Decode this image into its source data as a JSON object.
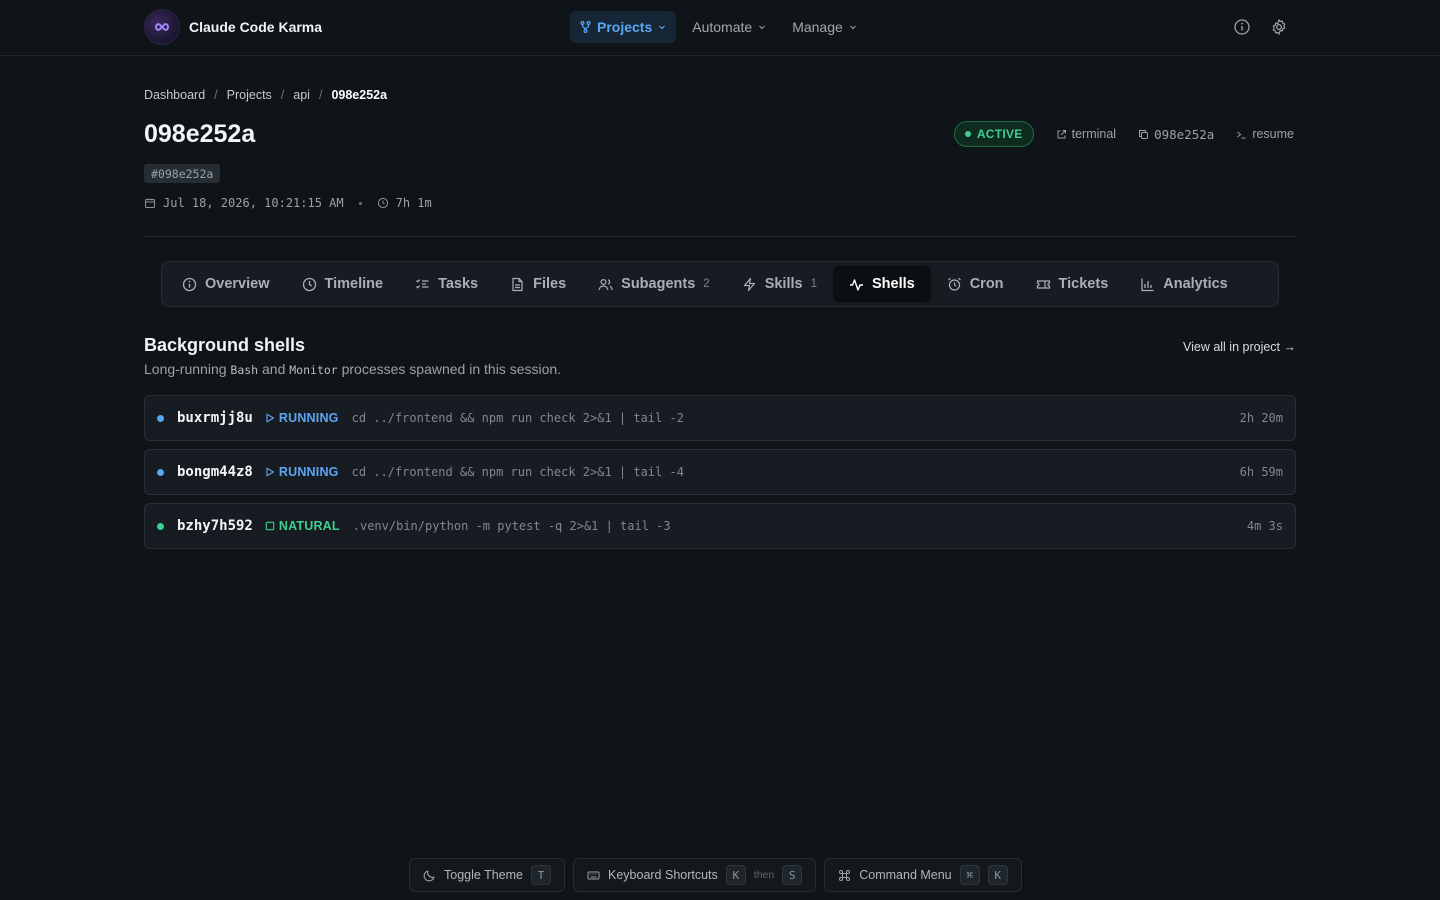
{
  "app": {
    "name": "Claude Code Karma"
  },
  "nav": {
    "items": [
      {
        "label": "Projects",
        "active": true,
        "icon": "git-branch-icon"
      },
      {
        "label": "Automate",
        "active": false
      },
      {
        "label": "Manage",
        "active": false
      }
    ]
  },
  "breadcrumb": [
    "Dashboard",
    "Projects",
    "api",
    "098e252a"
  ],
  "session": {
    "title": "098e252a",
    "hash": "#098e252a",
    "date": "Jul 18, 2026, 10:21:15 AM",
    "duration": "7h 1m",
    "status": "ACTIVE"
  },
  "actions": {
    "terminal": "terminal",
    "copy": "098e252a",
    "resume": "resume"
  },
  "tabs": [
    {
      "label": "Overview",
      "icon": "info-icon",
      "count": ""
    },
    {
      "label": "Timeline",
      "icon": "clock-icon",
      "count": ""
    },
    {
      "label": "Tasks",
      "icon": "list-checks-icon",
      "count": ""
    },
    {
      "label": "Files",
      "icon": "file-icon",
      "count": ""
    },
    {
      "label": "Subagents",
      "icon": "users-icon",
      "count": "2"
    },
    {
      "label": "Skills",
      "icon": "zap-icon",
      "count": "1"
    },
    {
      "label": "Shells",
      "icon": "activity-icon",
      "count": "",
      "active": true
    },
    {
      "label": "Cron",
      "icon": "alarm-clock-icon",
      "count": ""
    },
    {
      "label": "Tickets",
      "icon": "ticket-icon",
      "count": ""
    },
    {
      "label": "Analytics",
      "icon": "bar-chart-icon",
      "count": ""
    }
  ],
  "section": {
    "title": "Background shells",
    "sub_pre": "Long-running ",
    "sub_code1": "Bash",
    "sub_mid": " and ",
    "sub_code2": "Monitor",
    "sub_post": " processes spawned in this session.",
    "view_all": "View all in project →"
  },
  "shells": [
    {
      "id": "buxrmjj8u",
      "status": "RUNNING",
      "status_color": "#5aa6f2",
      "command": "cd ../frontend && npm run check 2>&1 | tail -2",
      "duration": "2h 20m"
    },
    {
      "id": "bongm44z8",
      "status": "RUNNING",
      "status_color": "#5aa6f2",
      "command": "cd ../frontend && npm run check 2>&1 | tail -4",
      "duration": "6h 59m"
    },
    {
      "id": "bzhy7h592",
      "status": "NATURAL",
      "status_color": "#3ecf8e",
      "command": ".venv/bin/python -m pytest -q 2>&1 | tail -3",
      "duration": "4m 3s"
    }
  ],
  "bottom": {
    "toggle_theme": "Toggle Theme",
    "toggle_key": "T",
    "shortcuts": "Keyboard Shortcuts",
    "shortcuts_k1": "K",
    "then": "then",
    "shortcuts_k2": "S",
    "command_menu": "Command Menu",
    "cmd_k1": "⌘",
    "cmd_k2": "K"
  }
}
